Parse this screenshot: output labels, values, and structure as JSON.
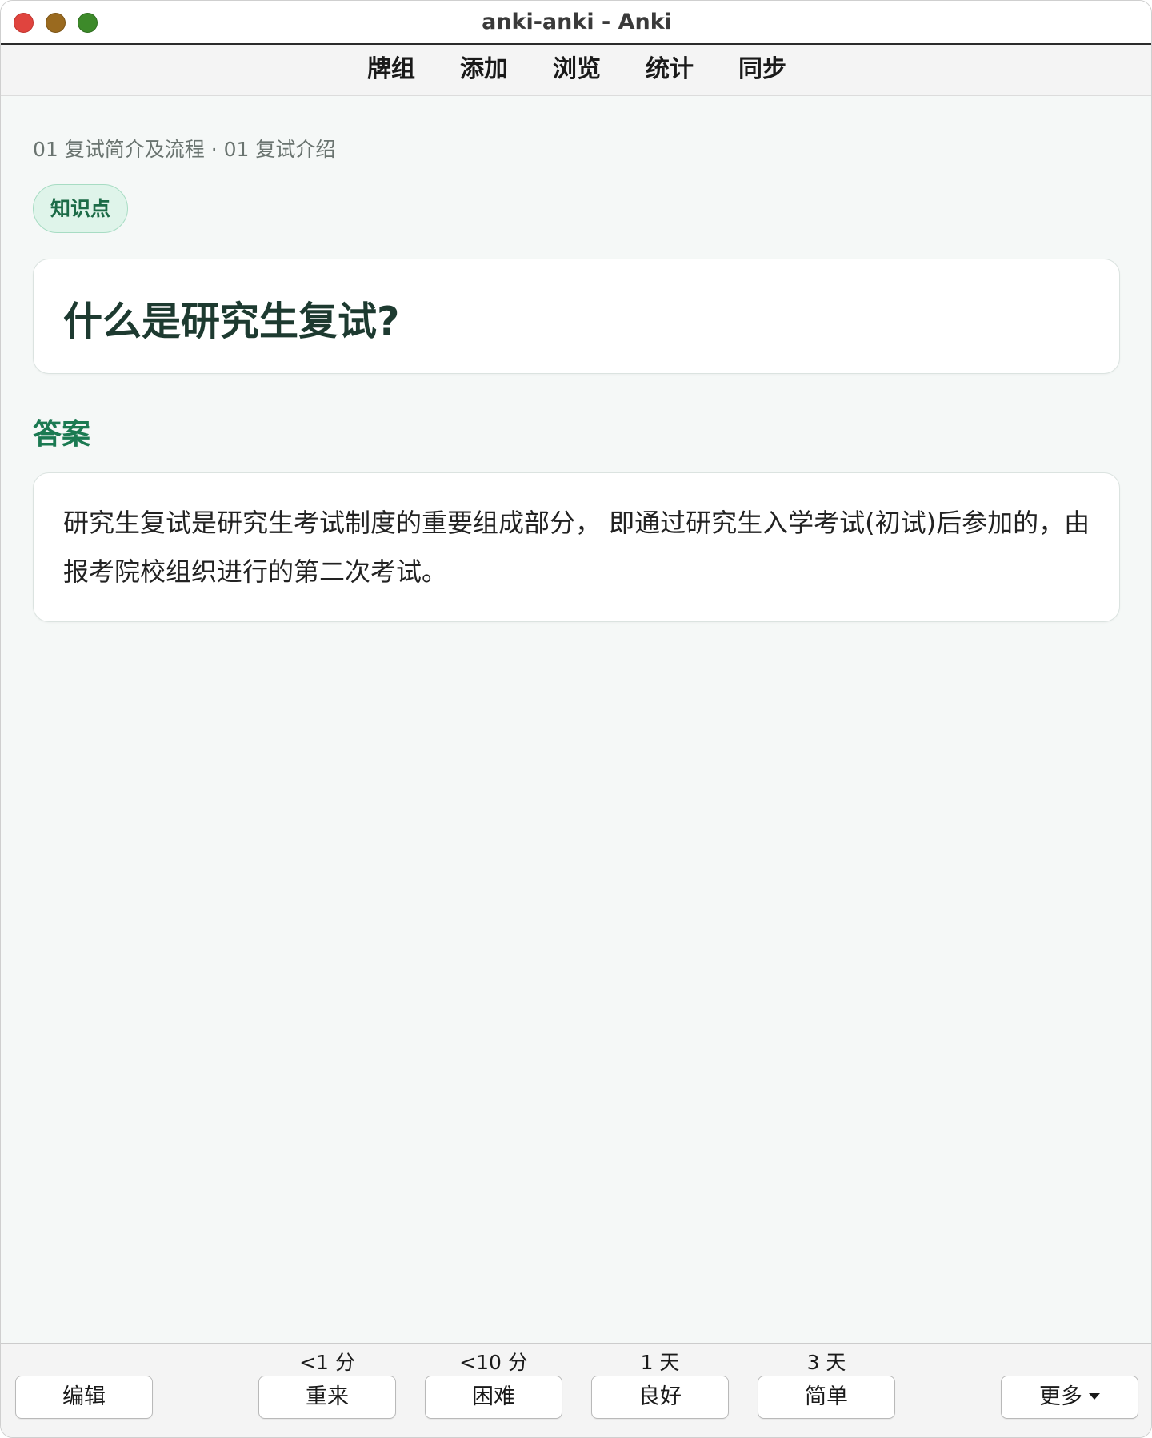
{
  "window": {
    "title": "anki-anki - Anki"
  },
  "toolbar": {
    "items": [
      "牌组",
      "添加",
      "浏览",
      "统计",
      "同步"
    ]
  },
  "card": {
    "breadcrumb": "01 复试简介及流程 · 01 复试介绍",
    "tag": "知识点",
    "question": "什么是研究生复试?",
    "answer_heading": "答案",
    "answer": "研究生复试是研究生考试制度的重要组成部分， 即通过研究生入学考试(初试)后参加的，由报考院校组织进行的第二次考试。"
  },
  "bottom": {
    "edit_label": "编辑",
    "more_label": "更多",
    "answers": [
      {
        "interval": "<1 分",
        "label": "重来"
      },
      {
        "interval": "<10 分",
        "label": "困难"
      },
      {
        "interval": "1 天",
        "label": "良好"
      },
      {
        "interval": "3 天",
        "label": "简单"
      }
    ]
  },
  "colors": {
    "accent": "#1b7a52",
    "tag_bg": "#dff4ea",
    "background": "#f5f8f7"
  }
}
